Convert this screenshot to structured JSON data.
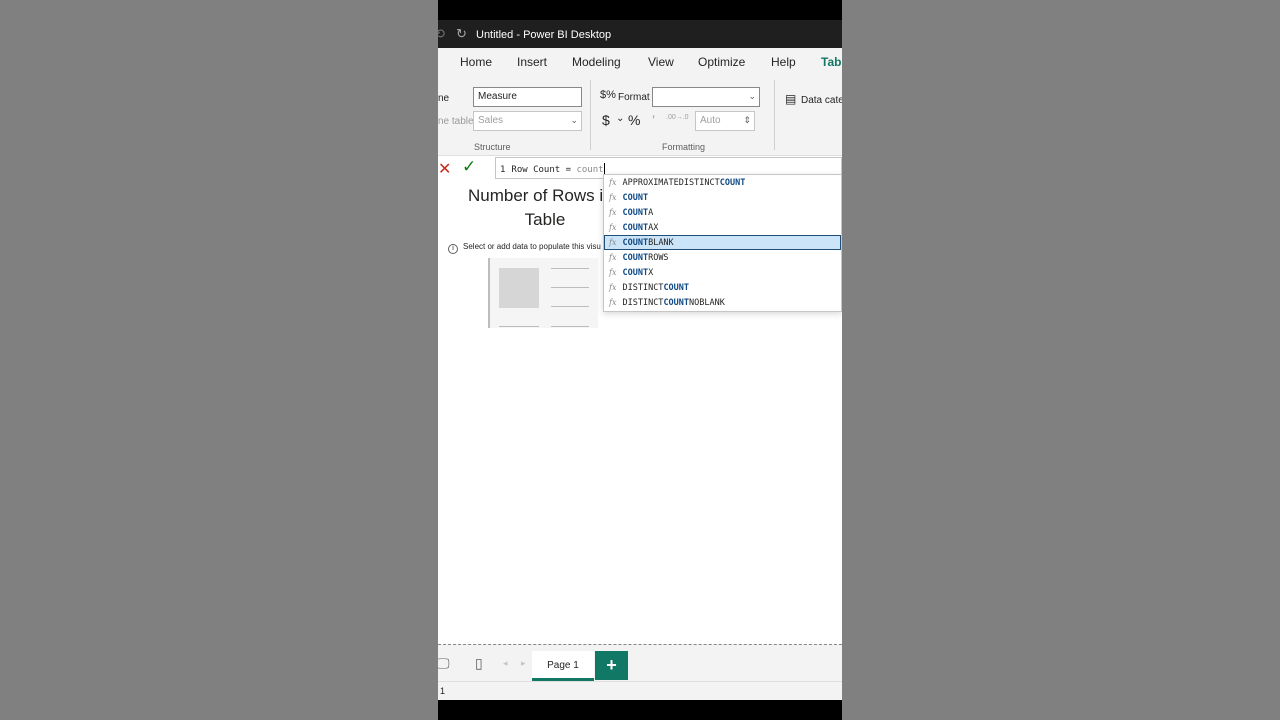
{
  "window": {
    "title": "Untitled - Power BI Desktop"
  },
  "menu": {
    "tabs": [
      "Home",
      "Insert",
      "Modeling",
      "View",
      "Optimize",
      "Help",
      "Tabl"
    ],
    "active_tab": "Tabl"
  },
  "ribbon": {
    "structure": {
      "name_label": "ne",
      "name_value": "Measure",
      "home_table_label": "ne table",
      "home_table_value": "Sales",
      "group_name": "Structure"
    },
    "formatting": {
      "format_label": "Format",
      "format_value": "",
      "currency_symbol": "$",
      "percent_symbol": "%",
      "comma_symbol": "’",
      "decimal_symbols": ".00→.0",
      "decimals_value": "Auto",
      "group_name": "Formatting"
    },
    "properties": {
      "data_category_label": "Data cate"
    }
  },
  "formula_bar": {
    "line_number": "1",
    "text": "Row Count = ",
    "typed": "count",
    "cancel_icon": "close-icon",
    "commit_icon": "check-icon"
  },
  "canvas": {
    "visual_title_line1": "Number of Rows i",
    "visual_title_line2": "Table",
    "hint_text": "Select or add data to populate this visu"
  },
  "autocomplete": {
    "items": [
      {
        "pre": "APPROXIMATEDISTINCT",
        "match": "COUNT",
        "post": "",
        "selected": false
      },
      {
        "pre": "",
        "match": "COUNT",
        "post": "",
        "selected": false
      },
      {
        "pre": "",
        "match": "COUNT",
        "post": "A",
        "selected": false
      },
      {
        "pre": "",
        "match": "COUNT",
        "post": "AX",
        "selected": false
      },
      {
        "pre": "",
        "match": "COUNT",
        "post": "BLANK",
        "selected": true
      },
      {
        "pre": "",
        "match": "COUNT",
        "post": "ROWS",
        "selected": false
      },
      {
        "pre": "",
        "match": "COUNT",
        "post": "X",
        "selected": false
      },
      {
        "pre": "DISTINCT",
        "match": "COUNT",
        "post": "",
        "selected": false
      },
      {
        "pre": "DISTINCT",
        "match": "COUNT",
        "post": "NOBLANK",
        "selected": false
      }
    ],
    "fx_label": "fx"
  },
  "pages": {
    "tabs": [
      "Page 1"
    ],
    "add_label": "+"
  },
  "status": {
    "page_indicator": "1"
  },
  "colors": {
    "accent": "#117865",
    "selection": "#cce4f7",
    "match_highlight": "#0f4a85"
  }
}
